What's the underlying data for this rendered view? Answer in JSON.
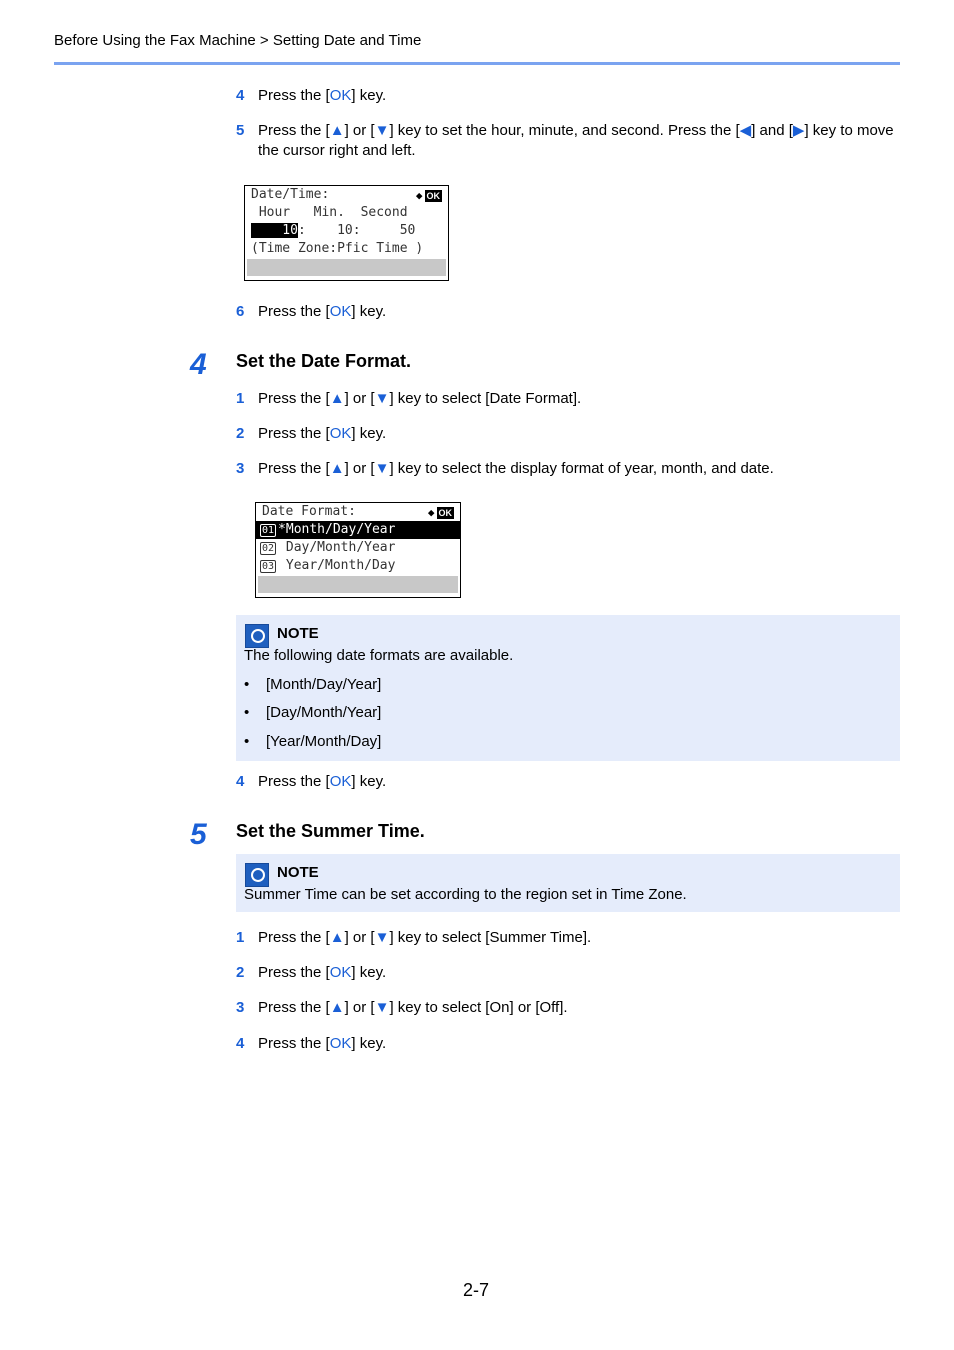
{
  "header": {
    "breadcrumb": "Before Using the Fax Machine > Setting Date and Time"
  },
  "steps_top": [
    {
      "num": "4",
      "parts": [
        "Press the [",
        "OK",
        "] key."
      ]
    },
    {
      "num": "5",
      "text": "Press the [▲] or [▼] key to set the hour, minute, and second. Press the [◀] and [▶] key to move the cursor right and left."
    },
    {
      "num": "6",
      "parts": [
        "Press the [",
        "OK",
        "] key."
      ]
    }
  ],
  "lcd_time": {
    "title": "Date/Time:",
    "labels": " Hour   Min.  Second",
    "hour": "    10",
    "rest": ":    10:     50",
    "tz": "(Time Zone:Pfic Time )",
    "ok": "OK",
    "move": "◆"
  },
  "section4": {
    "num": "4",
    "title": "Set the Date Format.",
    "steps": [
      {
        "num": "1",
        "text": "Press the [▲] or [▼] key to select [Date Format]."
      },
      {
        "num": "2",
        "parts": [
          "Press the [",
          "OK",
          "] key."
        ]
      },
      {
        "num": "3",
        "text": "Press the [▲] or [▼] key to select the display format of year, month, and date."
      },
      {
        "num": "4",
        "parts": [
          "Press the [",
          "OK",
          "] key."
        ]
      }
    ],
    "lcd": {
      "title": "Date Format:",
      "ok": "OK",
      "move": "◆",
      "options": [
        {
          "n": "01",
          "label": "*Month/Day/Year"
        },
        {
          "n": "02",
          "label": " Day/Month/Year"
        },
        {
          "n": "03",
          "label": " Year/Month/Day"
        }
      ]
    },
    "note": {
      "title": "NOTE",
      "body": "The following date formats are available.",
      "bullets": [
        "[Month/Day/Year]",
        "[Day/Month/Year]",
        "[Year/Month/Day]"
      ],
      "bullet_char": "•"
    }
  },
  "section5": {
    "num": "5",
    "title": "Set the Summer Time.",
    "note": {
      "title": "NOTE",
      "body": "Summer Time can be set according to the region set in Time Zone."
    },
    "steps": [
      {
        "num": "1",
        "text": "Press the [▲] or [▼] key to select [Summer Time]."
      },
      {
        "num": "2",
        "parts": [
          "Press the [",
          "OK",
          "] key."
        ]
      },
      {
        "num": "3",
        "text": "Press the [▲] or [▼] key to select [On] or [Off]."
      },
      {
        "num": "4",
        "parts": [
          "Press the [",
          "OK",
          "] key."
        ]
      }
    ]
  },
  "footer": {
    "page": "2-7"
  }
}
